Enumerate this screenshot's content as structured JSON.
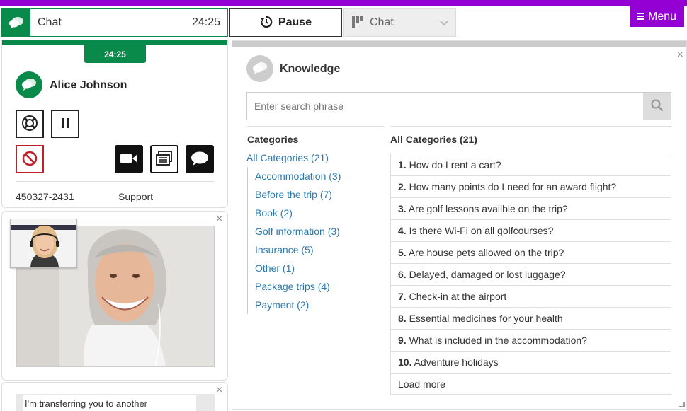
{
  "topbar": {
    "chat_tab": {
      "label": "Chat",
      "time": "24:25",
      "icon": "chat-bubbles-icon"
    },
    "pause_button": {
      "label": "Pause",
      "icon": "pause-clock-icon"
    },
    "channel_select": {
      "label": "Chat",
      "icon": "kanban-icon"
    },
    "menu_button": {
      "label": "Menu",
      "icon": "hamburger-icon"
    }
  },
  "contact": {
    "timer": "24:25",
    "name": "Alice Johnson",
    "id": "450327-2431",
    "queue": "Support",
    "actions": [
      "lifebuoy-icon",
      "pause-icon",
      "block-icon",
      "video-icon",
      "keyboard-icon",
      "chat-icon"
    ]
  },
  "message": {
    "text": "I'm transferring you to another"
  },
  "knowledge": {
    "title": "Knowledge",
    "search_placeholder": "Enter search phrase",
    "categories_title": "Categories",
    "all_categories_link": "All Categories (21)",
    "categories": [
      "Accommodation (3)",
      "Before the trip (7)",
      "Book (2)",
      "Golf information (3)",
      "Insurance (5)",
      "Other (1)",
      "Package trips (4)",
      "Payment (2)"
    ],
    "list_title": "All Categories (21)",
    "questions": [
      {
        "num": "1.",
        "text": "How do I rent a cart?"
      },
      {
        "num": "2.",
        "text": "How many points do I need for an award flight?"
      },
      {
        "num": "3.",
        "text": "Are golf lessons availble on the trip?"
      },
      {
        "num": "4.",
        "text": "Is there Wi-Fi on all golfcourses?"
      },
      {
        "num": "5.",
        "text": "Are house pets allowed on the trip?"
      },
      {
        "num": "6.",
        "text": "Delayed, damaged or lost luggage?"
      },
      {
        "num": "7.",
        "text": "Check-in at the airport"
      },
      {
        "num": "8.",
        "text": "Essential medicines for your health"
      },
      {
        "num": "9.",
        "text": "What is included in the accommodation?"
      },
      {
        "num": "10.",
        "text": "Adventure holidays"
      }
    ],
    "load_more": "Load more"
  },
  "colors": {
    "brand_purple": "#9400d3",
    "accent_green": "#0a8a4a",
    "danger_red": "#c0202a",
    "link_blue": "#2a7ab0"
  }
}
